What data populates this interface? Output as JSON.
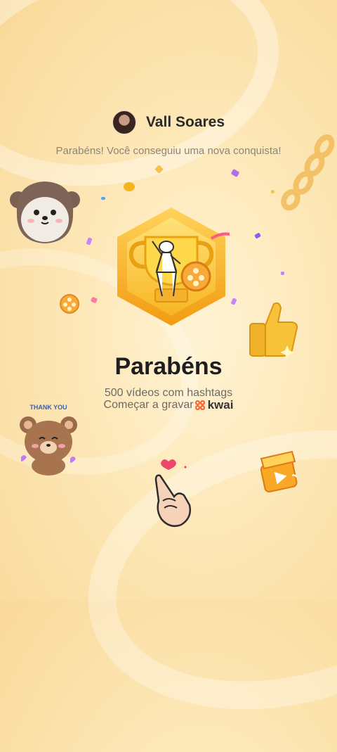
{
  "user": {
    "name": "Vall Soares"
  },
  "subtitle": "Parabéns! Você conseguiu uma nova conquista!",
  "achievement": {
    "title": "Parabéns",
    "description": "500 vídeos com hashtags",
    "cta_text": "Começar a gravar",
    "brand": "kwai"
  },
  "stickers": {
    "thank_you_text": "THANK YOU"
  },
  "colors": {
    "accent_orange": "#ff5a2a",
    "medal_gold": "#f8b523",
    "background": "#fde7b6"
  }
}
